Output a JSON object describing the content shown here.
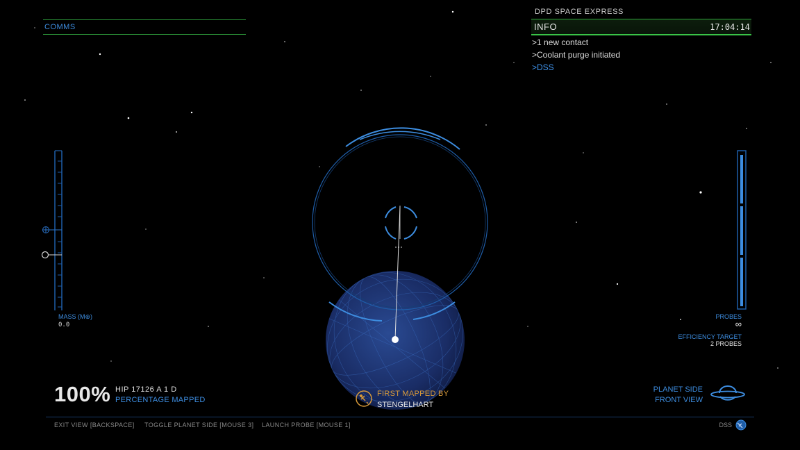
{
  "comms": {
    "label": "COMMS"
  },
  "info": {
    "ship_name": "DPD SPACE EXPRESS",
    "title": "INFO",
    "time": "17:04:14",
    "messages": [
      {
        "text": ">1 new contact",
        "color": "#dcdcdc"
      },
      {
        "text": ">Coolant purge initiated",
        "color": "#dcdcdc"
      },
      {
        "text": ">DSS",
        "color": "#3f95ef"
      }
    ]
  },
  "mass_gauge": {
    "label": "MASS (M⊕)",
    "value": "0.0"
  },
  "probes": {
    "label": "PROBES",
    "count": "∞",
    "efficiency_label": "EFFICIENCY TARGET",
    "efficiency_value": "2 PROBES"
  },
  "mapping": {
    "percent": "100%",
    "body_name": "HIP 17126 A 1 D",
    "percent_label": "PERCENTAGE MAPPED"
  },
  "first_mapped": {
    "label": "FIRST MAPPED BY",
    "name": "STENGELHART"
  },
  "view": {
    "side": "PLANET SIDE",
    "view": "FRONT VIEW"
  },
  "controls": {
    "exit": "EXIT VIEW [BACKSPACE]",
    "toggle": "TOGGLE PLANET SIDE [MOUSE 3]",
    "launch": "LAUNCH PROBE [MOUSE 1]",
    "dss": "DSS"
  },
  "colors": {
    "accent_blue": "#3d8de0",
    "hud_green": "#39c447",
    "gold": "#d89a3a",
    "planet": "#1e3a78"
  }
}
